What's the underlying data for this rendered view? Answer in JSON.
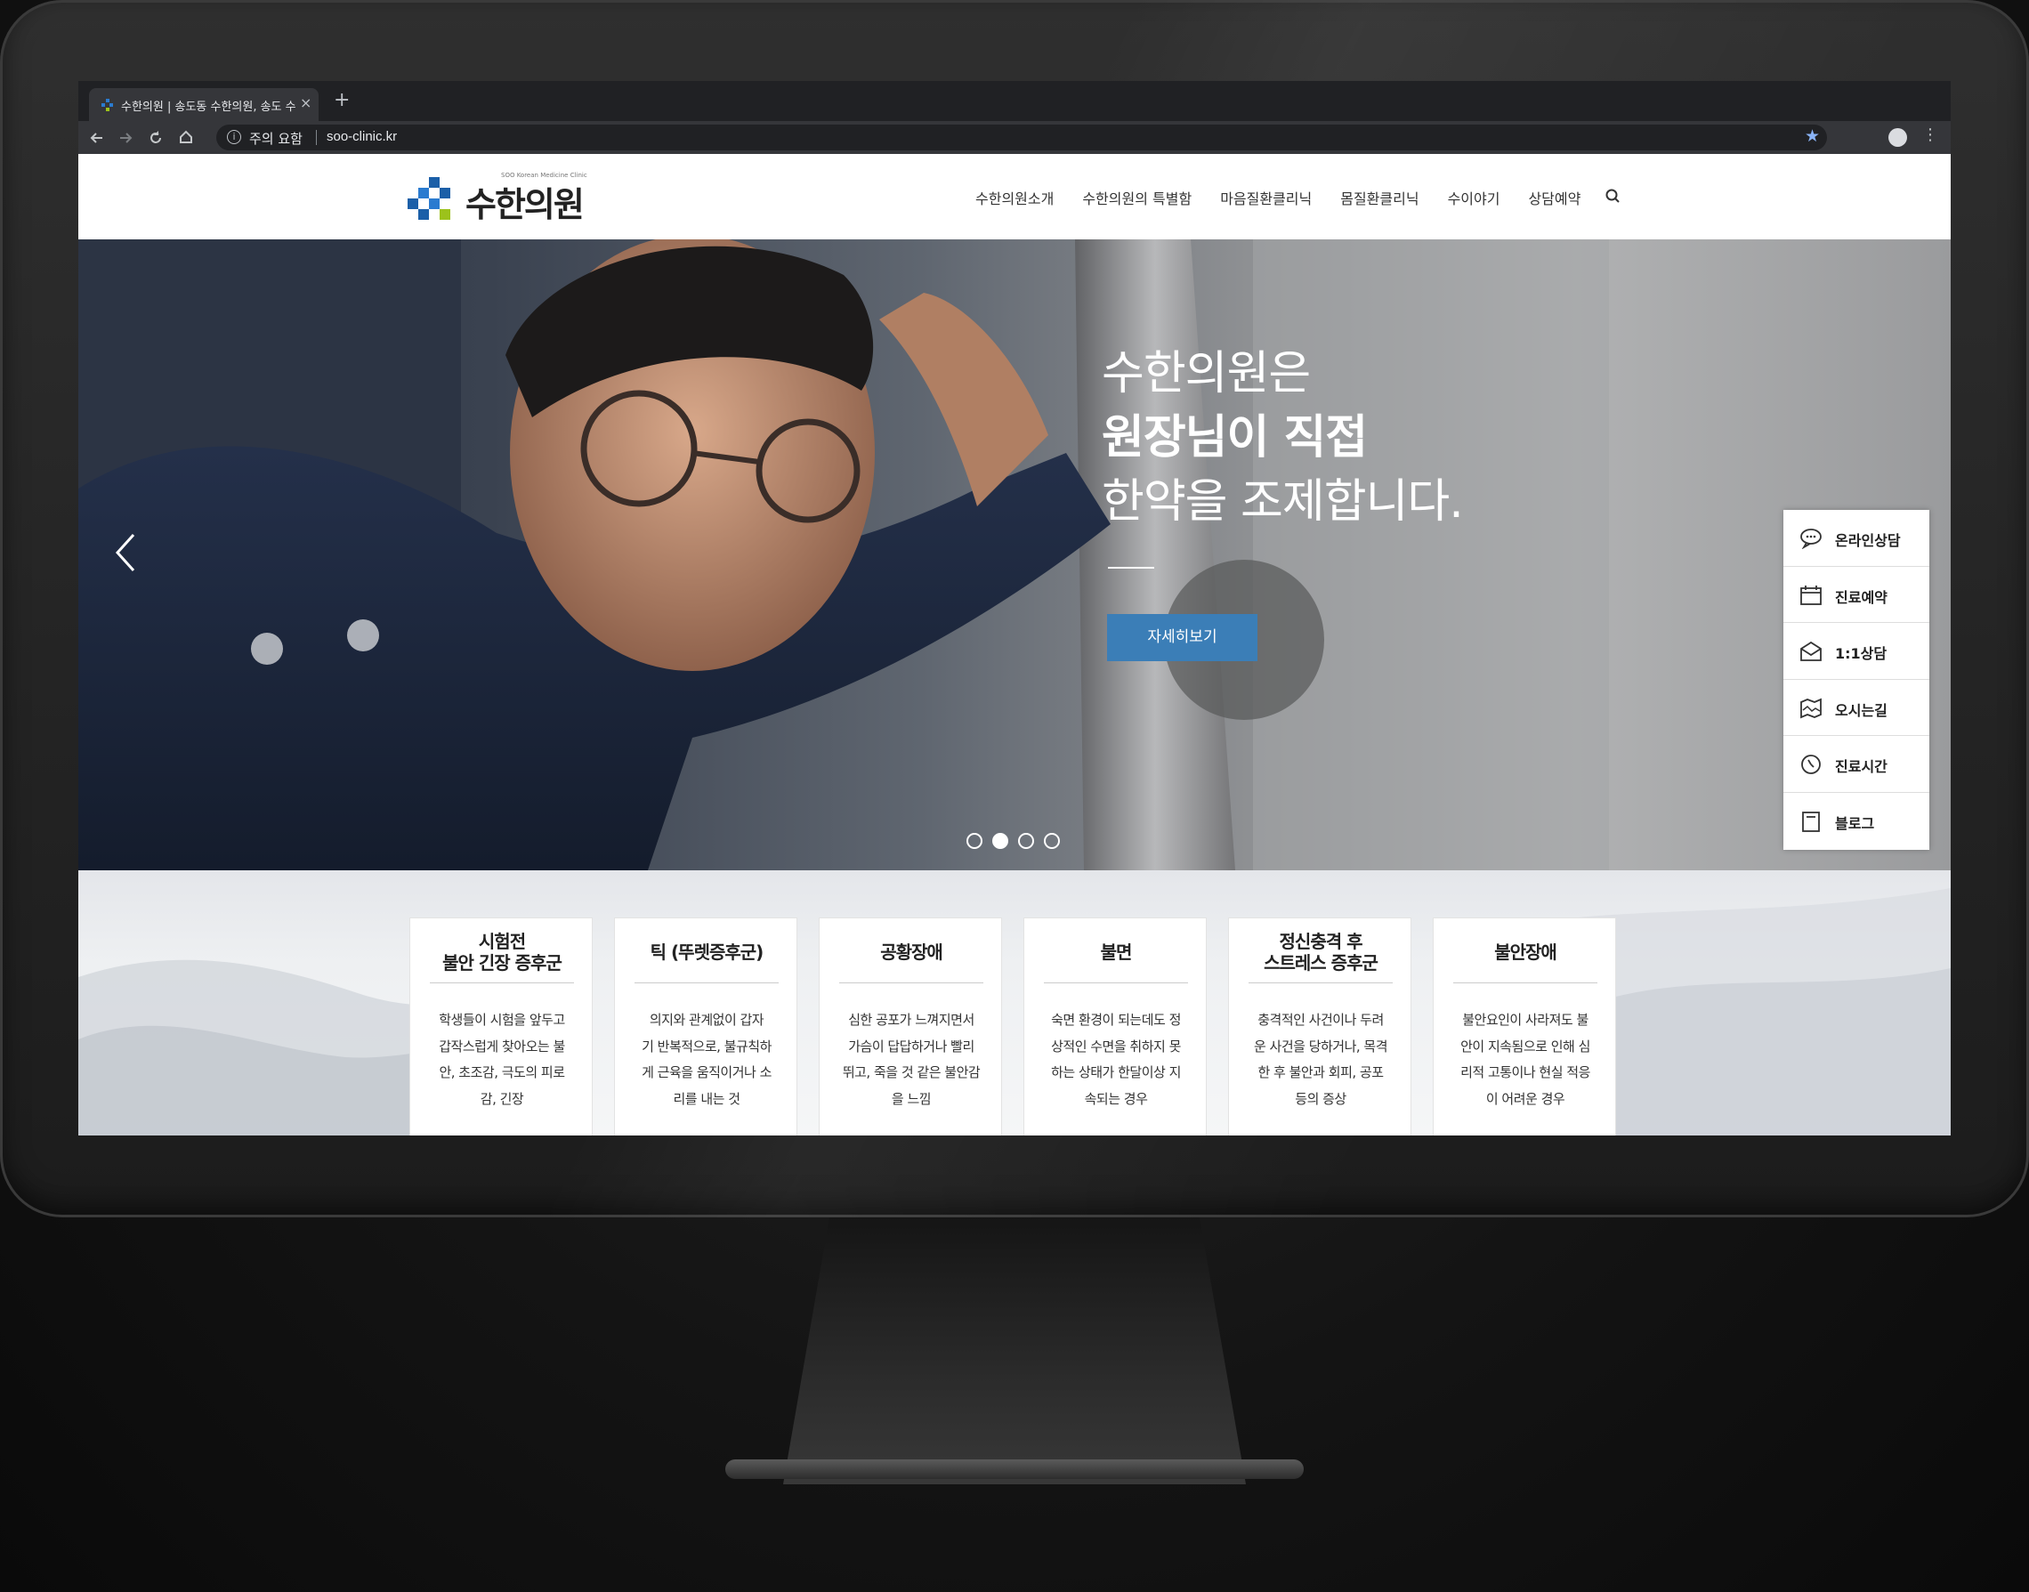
{
  "browser": {
    "tab_title": "수한의원 | 송도동 수한의원, 송도 수한",
    "close_glyph": "×",
    "new_tab_glyph": "+",
    "security_label": "주의 요함",
    "url": "soo-clinic.kr"
  },
  "site": {
    "logo_text": "수한의원",
    "logo_subtitle": "SOO Korean Medicine Clinic",
    "nav": [
      {
        "label": "수한의원소개"
      },
      {
        "label": "수한의원의 특별함"
      },
      {
        "label": "마음질환클리닉"
      },
      {
        "label": "몸질환클리닉"
      },
      {
        "label": "수이야기"
      },
      {
        "label": "상담예약"
      }
    ]
  },
  "hero": {
    "line1": "수한의원은",
    "line2": "원장님이 직접",
    "line3": "한약을 조제합니다.",
    "button_label": "자세히보기",
    "slide_count": 4,
    "active_slide": 2
  },
  "quick_menu": [
    {
      "label": "온라인상담",
      "icon": "speech-bubble-icon"
    },
    {
      "label": "진료예약",
      "icon": "calendar-icon"
    },
    {
      "label": "1:1상담",
      "icon": "envelope-icon"
    },
    {
      "label": "오시는길",
      "icon": "map-icon"
    },
    {
      "label": "진료시간",
      "icon": "clock-icon"
    },
    {
      "label": "블로그",
      "icon": "blog-icon"
    }
  ],
  "cards": [
    {
      "title_1": "시험전",
      "title_2": "불안 긴장 증후군",
      "desc": [
        "학생들이 시험을 앞두고",
        "갑작스럽게 찾아오는 불",
        "안, 초조감, 극도의 피로",
        "감, 긴장"
      ]
    },
    {
      "title_1": "틱 (뚜렛증후군)",
      "title_2": "",
      "desc": [
        "의지와 관계없이 갑자",
        "기 반복적으로, 불규칙하",
        "게 근육을 움직이거나 소",
        "리를 내는 것"
      ]
    },
    {
      "title_1": "공황장애",
      "title_2": "",
      "desc": [
        "심한 공포가 느껴지면서",
        "가슴이 답답하거나  빨리",
        "뛰고, 죽을 것 같은 불안감",
        "을 느낌"
      ]
    },
    {
      "title_1": "불면",
      "title_2": "",
      "desc": [
        "숙면 환경이 되는데도 정",
        "상적인 수면을 취하지 못",
        "하는 상태가 한달이상 지",
        "속되는 경우"
      ]
    },
    {
      "title_1": "정신충격 후",
      "title_2": "스트레스 증후군",
      "desc": [
        "충격적인 사건이나 두려",
        "운 사건을 당하거나, 목격",
        "한 후 불안과 회피, 공포",
        "등의 증상"
      ]
    },
    {
      "title_1": "불안장애",
      "title_2": "",
      "desc": [
        "불안요인이 사라져도 불",
        "안이 지속됨으로 인해 심",
        "리적 고통이나 현실 적응",
        "이 어려운 경우"
      ]
    }
  ],
  "colors": {
    "accent_button": "#3b7eb7",
    "logo_blue": "#1b5fa8",
    "logo_green": "#9cc21b",
    "chrome_dark": "#202124"
  }
}
